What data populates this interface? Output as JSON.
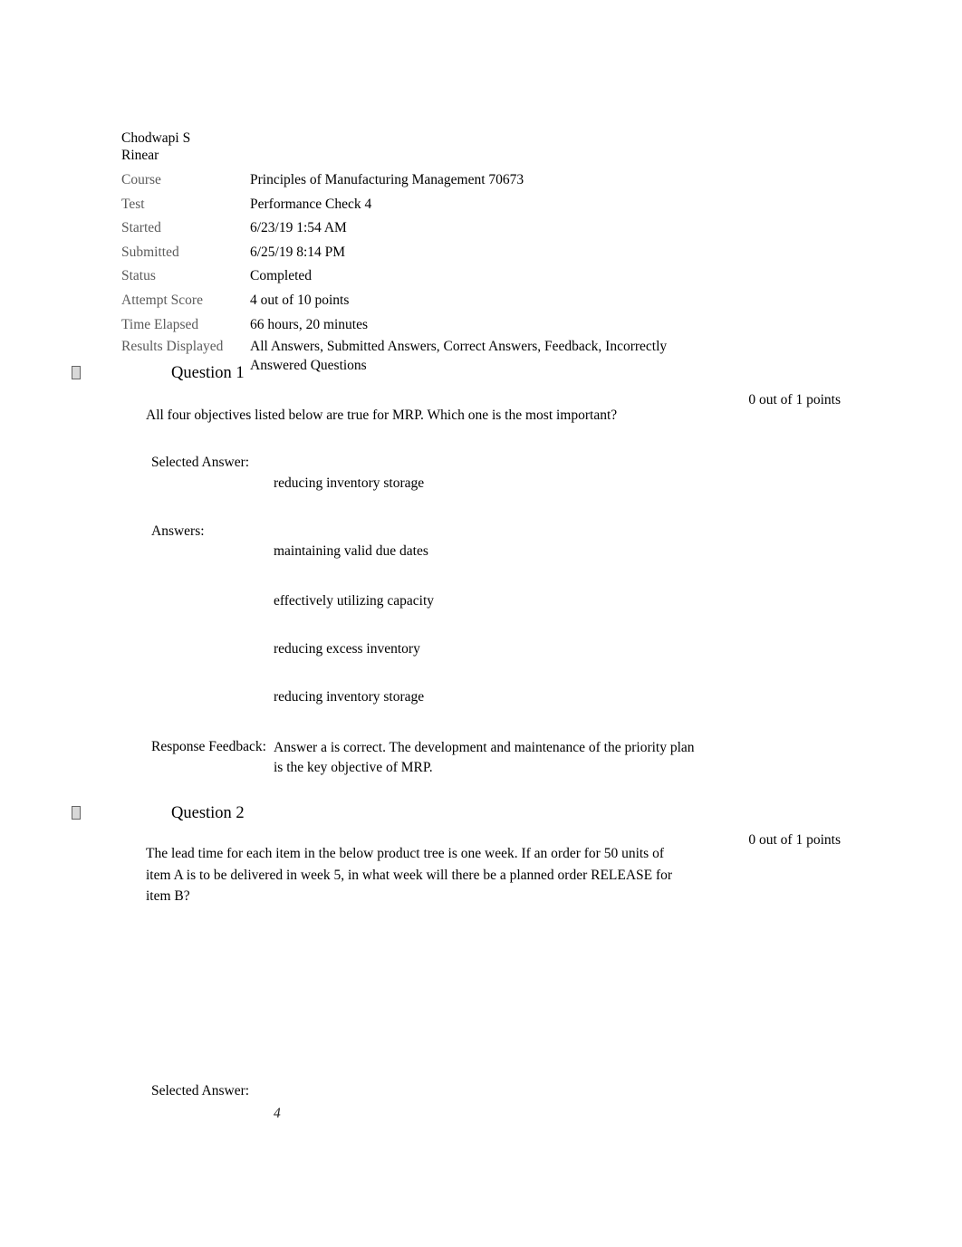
{
  "student": {
    "name": "Chodwapi S Rinear"
  },
  "meta": [
    {
      "label": "Course",
      "value": "Principles of Manufacturing Management 70673"
    },
    {
      "label": "Test",
      "value": "Performance Check 4"
    },
    {
      "label": "Started",
      "value": "6/23/19 1:54 AM"
    },
    {
      "label": "Submitted",
      "value": "6/25/19 8:14 PM"
    },
    {
      "label": "Status",
      "value": "Completed"
    },
    {
      "label": "Attempt Score",
      "value": "4 out of 10 points"
    },
    {
      "label": "Time Elapsed",
      "value": "66 hours, 20 minutes"
    },
    {
      "label": "Results Displayed",
      "value": "All Answers, Submitted Answers, Correct Answers, Feedback, Incorrectly Answered Questions"
    }
  ],
  "labels": {
    "selected_answer": "Selected Answer:",
    "answers": "Answers:",
    "response_feedback": "Response Feedback:"
  },
  "questions": [
    {
      "title": "Question 1",
      "points": "0 out of 1 points",
      "text": "All four objectives listed below are true for MRP. Which one is the most important?",
      "selected_answer": "reducing inventory storage",
      "options": [
        "maintaining valid due dates",
        "effectively utilizing capacity",
        "reducing excess inventory",
        "reducing inventory storage"
      ],
      "feedback": "Answer a is correct. The development and maintenance of the priority plan is the key objective of MRP."
    },
    {
      "title": "Question 2",
      "points": "0 out of 1 points",
      "text": "The lead time for each item in the below product tree is one week. If an order for 50 units of item A is to be delivered in week 5, in what week will there be a planned order RELEASE for item B?",
      "selected_answer": "4"
    }
  ]
}
